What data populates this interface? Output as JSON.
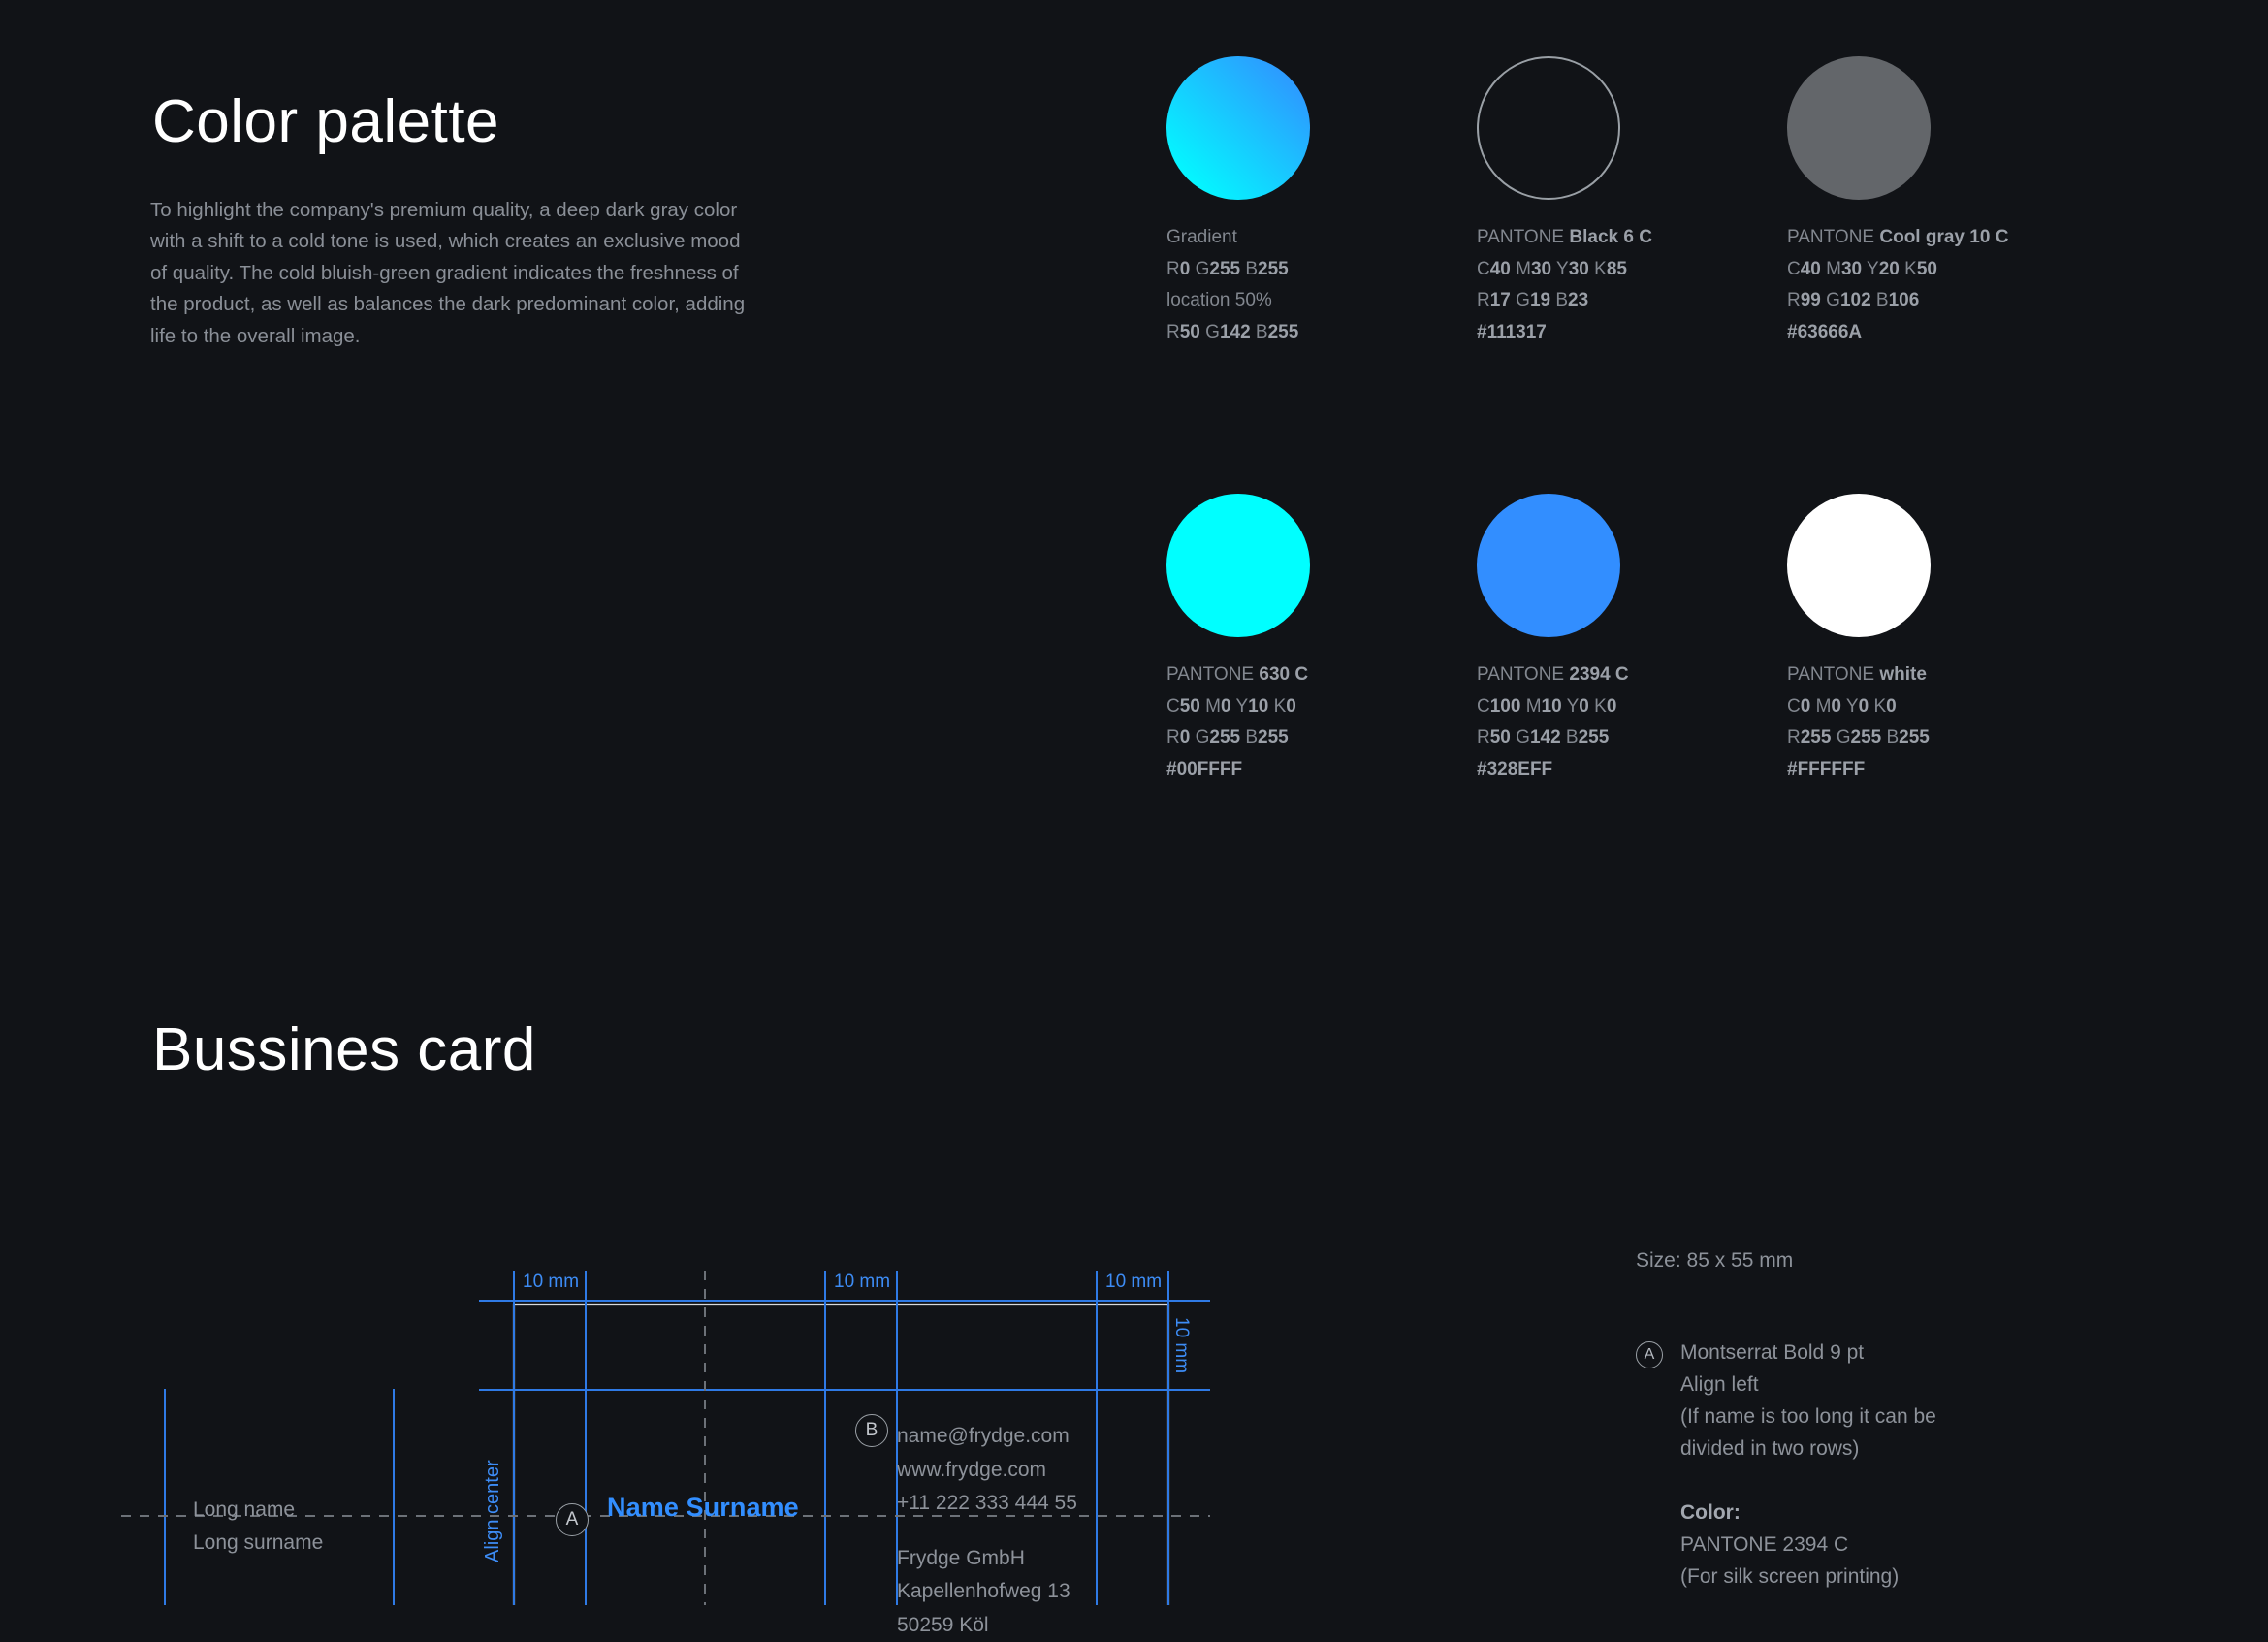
{
  "meta": {
    "background": "#111317",
    "accent_blue": "#328eff",
    "accent_cyan": "#00FFFF"
  },
  "palette": {
    "title": "Color palette",
    "description": "To highlight the company's premium quality, a deep dark gray color with a shift to a cold tone is used, which creates an exclusive mood of quality. The cold bluish-green gradient indicates the freshness of the product, as well as balances the dark predominant color, adding life to the overall image.",
    "swatches": [
      {
        "name_prefix": "Gradient",
        "name_bold": "",
        "style": "gradient",
        "line2": "R0  G255  B255",
        "line2_parts": [
          [
            "R",
            "0"
          ],
          [
            "G",
            "255"
          ],
          [
            "B",
            "255"
          ]
        ],
        "line3": "location 50%",
        "line4": "R50  G142  B255",
        "line4_parts": [
          [
            "R",
            "50"
          ],
          [
            "G",
            "142"
          ],
          [
            "B",
            "255"
          ]
        ],
        "hex": "",
        "swatch_color": "#00FFFF",
        "swatch_color_end": "#328EFF"
      },
      {
        "name_prefix": "PANTONE ",
        "name_bold": "Black 6 C",
        "style": "outline",
        "line2": "C40  M30  Y30  K85",
        "line3": "R17  G19  B23",
        "hex": "#111317",
        "swatch_color": "#111317"
      },
      {
        "name_prefix": "PANTONE ",
        "name_bold": "Cool gray 10 C",
        "style": "solid",
        "line2": "C40  M30  Y20  K50",
        "line3": "R99  G102  B106",
        "hex": "#63666A",
        "swatch_color": "#63666A"
      },
      {
        "name_prefix": "PANTONE ",
        "name_bold": "630 C",
        "style": "solid",
        "line2": "C50  M0  Y10  K0",
        "line3": "R0  G255  B255",
        "hex": "#00FFFF",
        "swatch_color": "#00FFFF"
      },
      {
        "name_prefix": "PANTONE ",
        "name_bold": "2394 C",
        "style": "solid",
        "line2": "C100  M10  Y0  K0",
        "line3": "R50  G142  B255",
        "hex": "#328EFF",
        "swatch_color": "#328EFF"
      },
      {
        "name_prefix": "PANTONE ",
        "name_bold": "white",
        "style": "solid",
        "line2": "C0  M0  Y0  K0",
        "line3": "R255  G255  B255",
        "hex": "#FFFFFF",
        "swatch_color": "#FFFFFF"
      }
    ]
  },
  "business_card": {
    "title": "Bussines card",
    "margins": {
      "top_left": "10 mm",
      "top_mid": "10 mm",
      "top_right": "10 mm",
      "right_vertical": "10 mm"
    },
    "align_label": "Align center",
    "markers": {
      "a": "A",
      "b": "B"
    },
    "name_line": "Name Surname",
    "long_name": "Long name",
    "long_surname": "Long surname",
    "contact": {
      "email": "name@frydge.com",
      "website": "www.frydge.com",
      "phone": "+11 222 333 444 55",
      "company": "Frydge GmbH",
      "street": "Kapellenhofweg 13",
      "city": "50259 Köl"
    },
    "notes": {
      "size": "Size: 85 x 55 mm",
      "font_spec": "Montserrat Bold 9 pt",
      "align": "Align left",
      "hint_line1": "(If name is too long it can be",
      "hint_line2": "divided in two rows)",
      "color_label": "Color:",
      "color_value": "PANTONE 2394 C",
      "color_note": "(For silk screen printing)"
    }
  }
}
